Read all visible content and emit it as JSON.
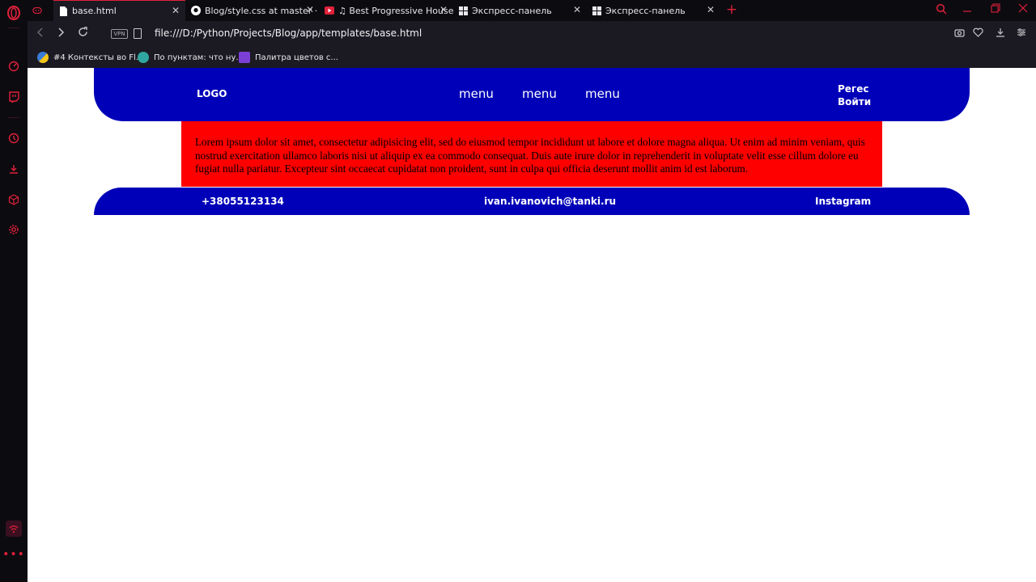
{
  "browser": {
    "tabs": [
      {
        "title": "base.html",
        "active": true,
        "icon": "file-icon"
      },
      {
        "title": "Blog/style.css at master · iN",
        "active": false,
        "icon": "github-icon"
      },
      {
        "title": "♫ Best Progressive House M",
        "active": false,
        "icon": "youtube-icon"
      },
      {
        "title": "Экспресс-панель",
        "active": false,
        "icon": "grid-icon"
      },
      {
        "title": "Экспресс-панель",
        "active": false,
        "icon": "grid-icon"
      }
    ],
    "vpn_label": "VPN",
    "url": "file:///D:/Python/Projects/Blog/app/templates/base.html",
    "bookmarks": [
      {
        "label": "#4 Контексты во Fl...",
        "color": "#3a7bd5"
      },
      {
        "label": "По пунктам: что ну...",
        "color": "#2fa6a0"
      },
      {
        "label": "Палитра цветов с...",
        "color": "#7b3fd6"
      }
    ],
    "accent": "#e0213a"
  },
  "page": {
    "header": {
      "logo": "LOGO",
      "menu": [
        "menu",
        "menu",
        "menu"
      ],
      "register": "Регес",
      "login": "Войти"
    },
    "content": {
      "text": "Lorem ipsum dolor sit amet, consectetur adipisicing elit, sed do eiusmod tempor incididunt ut labore et dolore magna aliqua. Ut enim ad minim veniam, quis nostrud exercitation ullamco laboris nisi ut aliquip ex ea commodo consequat. Duis aute irure dolor in reprehenderit in voluptate velit esse cillum dolore eu fugiat nulla pariatur. Excepteur sint occaecat cupidatat non proident, sunt in culpa qui officia deserunt mollit anim id est laborum."
    },
    "footer": {
      "phone": "+38055123134",
      "email": "ivan.ivanovich@tanki.ru",
      "social": "Instagram"
    },
    "colors": {
      "header_bg": "#0000b8",
      "content_bg": "#ff0000",
      "footer_bg": "#0000b8"
    }
  }
}
